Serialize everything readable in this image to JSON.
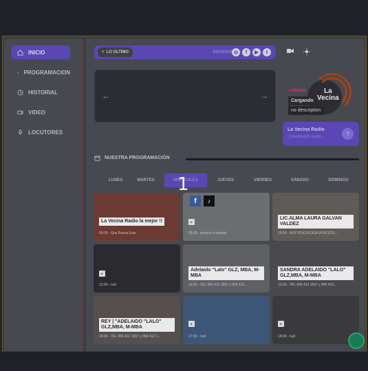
{
  "sidebar": {
    "items": [
      {
        "label": "INICIO",
        "icon": "home-icon",
        "active": true
      },
      {
        "label": "PROGRAMACION",
        "icon": "calendar-icon",
        "active": false
      },
      {
        "label": "HISTORIAL",
        "icon": "history-icon",
        "active": false
      },
      {
        "label": "VIDEO",
        "icon": "video-icon",
        "active": false
      },
      {
        "label": "LOCUTORES",
        "icon": "microphone-icon",
        "active": false
      }
    ]
  },
  "topstrip": {
    "lo_ultimo": "LO ÚLTIMO",
    "siguenos": "SIGUENOS",
    "socials": [
      "instagram-icon",
      "facebook-icon",
      "youtube-icon",
      "twitter-icon"
    ]
  },
  "player": {
    "live_label": "• Directo",
    "logo_line1": "La",
    "logo_line2": "Vecina",
    "status": "Cargando",
    "description": "no description",
    "station_name": "La Vecina Radio",
    "station_sub": "Conectando audio..."
  },
  "schedule": {
    "title": "NUESTRA PROGRAMACIÓN",
    "days": [
      "LUNES",
      "MARTES",
      "MIÉRCOLES",
      "JUEVES",
      "VIERNES",
      "SÁBADO",
      "DOMINGO"
    ],
    "active_day": 2,
    "overlay_number": "1"
  },
  "cards": [
    {
      "title": "La Vecina Radio la mejor !!",
      "sub": "00:00 - Que Buena Este",
      "bg": "#6b3a33"
    },
    {
      "title": "",
      "sub": "09:00 - primero el pueblo",
      "bg": "#6b6d70"
    },
    {
      "title": "LIC.ALMA LAURA GALVAN VALDEZ",
      "sub": "10:00 - SOY PSICOLOGA (PSICOTE...",
      "bg": "#5f5c58"
    },
    {
      "title": "",
      "sub": "12:00 - null",
      "bg": "#2b2a2f"
    },
    {
      "title": "Adelaido \"Lalo\" GLZ, MBA, M-MBA",
      "sub": "13:00 - TEL 956 412 1557 y 956 412...",
      "bg": "#5e6064"
    },
    {
      "title": "SANDRA ADELAIDO \"LALO\" GLZ,MBA, M-MBA",
      "sub": "13:00 - TEL 956 412 1557 y 956 412...",
      "bg": "#4a4a4e"
    },
    {
      "title": "REY | \"ADELAIDO \"LALO\" GLZ,MBA, M-MBA",
      "sub": "16:00 - TEL 956 412 1557 y 956 412 1...",
      "bg": "#55504d"
    },
    {
      "title": "",
      "sub": "17:00 - null",
      "bg": "#3d5677"
    },
    {
      "title": "",
      "sub": "18:00 - null",
      "bg": "#3a3a3c"
    }
  ],
  "colors": {
    "accent": "#5a47b3",
    "background": "#23252d",
    "panel": "#464950"
  }
}
